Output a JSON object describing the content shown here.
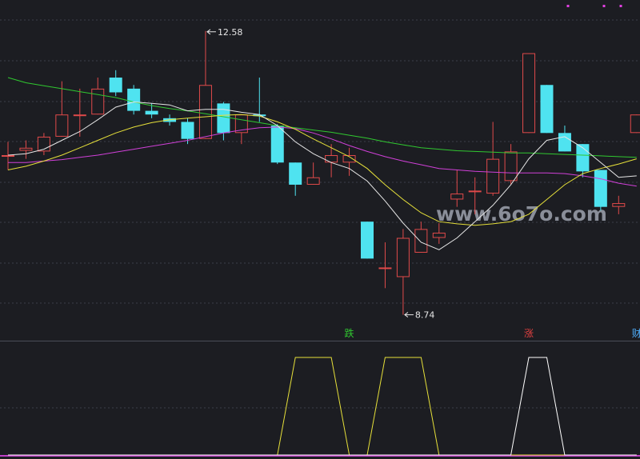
{
  "colors": {
    "background": "#1c1d22",
    "grid": "#3c3f4a",
    "divider": "#4a4d57",
    "up": "#e04a4a",
    "down": "#4fe3f0",
    "ma_white": "#e6e6e6",
    "ma_yellow": "#e6e03a",
    "ma_magenta": "#d040d8",
    "ma_green": "#30c830",
    "osc_yellow": "#e6e03a",
    "osc_white": "#ffffff",
    "baseline": "#c040c8",
    "marker": "#e040e0",
    "label_die": "#30c830",
    "label_zhang": "#e04040",
    "label_cai": "#4fb0ff",
    "watermark": "#8a8e99",
    "annotation": "#e6e6e6"
  },
  "watermark": "www.6o7o.com",
  "annotations": {
    "high_label": "12.58",
    "low_label": "8.74"
  },
  "signals": [
    {
      "text": "跌",
      "candle": 19,
      "color_key": "label_die"
    },
    {
      "text": "涨",
      "candle": 29,
      "color_key": "label_zhang"
    },
    {
      "text": "财",
      "candle": 35,
      "color_key": "label_cai"
    }
  ],
  "chart_data": {
    "type": "candlestick",
    "title": "",
    "ylim": [
      8.4,
      13.0
    ],
    "grid": true,
    "high_index": 11,
    "low_index": 22,
    "candles": [
      {
        "o": 10.9,
        "c": 10.9,
        "h": 11.08,
        "l": 10.7
      },
      {
        "o": 10.96,
        "c": 11.0,
        "h": 11.1,
        "l": 10.85
      },
      {
        "o": 10.95,
        "c": 11.15,
        "h": 11.2,
        "l": 10.9
      },
      {
        "o": 11.15,
        "c": 11.45,
        "h": 11.9,
        "l": 11.15
      },
      {
        "o": 11.45,
        "c": 11.45,
        "h": 11.8,
        "l": 11.15
      },
      {
        "o": 11.45,
        "c": 11.8,
        "h": 11.95,
        "l": 11.45
      },
      {
        "o": 11.95,
        "c": 11.75,
        "h": 12.05,
        "l": 11.7
      },
      {
        "o": 11.8,
        "c": 11.5,
        "h": 11.85,
        "l": 11.45
      },
      {
        "o": 11.5,
        "c": 11.45,
        "h": 11.6,
        "l": 11.4
      },
      {
        "o": 11.4,
        "c": 11.35,
        "h": 11.45,
        "l": 11.3
      },
      {
        "o": 11.35,
        "c": 11.12,
        "h": 11.4,
        "l": 11.05
      },
      {
        "o": 11.12,
        "c": 11.85,
        "h": 12.58,
        "l": 11.12
      },
      {
        "o": 11.6,
        "c": 11.2,
        "h": 11.62,
        "l": 11.1
      },
      {
        "o": 11.2,
        "c": 11.45,
        "h": 11.45,
        "l": 11.05
      },
      {
        "o": 11.45,
        "c": 11.43,
        "h": 11.95,
        "l": 11.35
      },
      {
        "o": 11.3,
        "c": 10.8,
        "h": 11.32,
        "l": 10.78
      },
      {
        "o": 10.8,
        "c": 10.5,
        "h": 10.8,
        "l": 10.35
      },
      {
        "o": 10.5,
        "c": 10.6,
        "h": 10.8,
        "l": 10.5
      },
      {
        "o": 10.8,
        "c": 10.9,
        "h": 11.05,
        "l": 10.6
      },
      {
        "o": 10.8,
        "c": 10.9,
        "h": 11.0,
        "l": 10.62
      },
      {
        "o": 10.0,
        "c": 9.5,
        "h": 10.0,
        "l": 9.5
      },
      {
        "o": 9.38,
        "c": 9.38,
        "h": 9.72,
        "l": 9.1
      },
      {
        "o": 9.25,
        "c": 9.78,
        "h": 9.9,
        "l": 8.74
      },
      {
        "o": 9.58,
        "c": 9.9,
        "h": 10.0,
        "l": 9.58
      },
      {
        "o": 9.78,
        "c": 9.85,
        "h": 9.98,
        "l": 9.7
      },
      {
        "o": 10.3,
        "c": 10.38,
        "h": 10.7,
        "l": 10.2
      },
      {
        "o": 10.42,
        "c": 10.42,
        "h": 10.6,
        "l": 10.1
      },
      {
        "o": 10.38,
        "c": 10.85,
        "h": 11.35,
        "l": 10.35
      },
      {
        "o": 10.55,
        "c": 10.95,
        "h": 11.05,
        "l": 10.5
      },
      {
        "o": 11.2,
        "c": 12.28,
        "h": 12.28,
        "l": 11.2
      },
      {
        "o": 11.85,
        "c": 11.2,
        "h": 11.85,
        "l": 11.2
      },
      {
        "o": 11.2,
        "c": 10.95,
        "h": 11.3,
        "l": 10.95
      },
      {
        "o": 11.05,
        "c": 10.68,
        "h": 11.05,
        "l": 10.6
      },
      {
        "o": 10.7,
        "c": 10.2,
        "h": 10.7,
        "l": 10.15
      },
      {
        "o": 10.2,
        "c": 10.25,
        "h": 10.35,
        "l": 10.1
      },
      {
        "o": 11.2,
        "c": 11.45,
        "h": 11.45,
        "l": 11.2
      }
    ],
    "ma_white": [
      10.9,
      10.92,
      10.98,
      11.1,
      11.22,
      11.38,
      11.55,
      11.62,
      11.6,
      11.58,
      11.5,
      11.52,
      11.52,
      11.48,
      11.45,
      11.3,
      11.08,
      10.92,
      10.8,
      10.72,
      10.55,
      10.28,
      9.98,
      9.72,
      9.62,
      9.78,
      10.0,
      10.22,
      10.5,
      10.85,
      11.1,
      11.15,
      11.0,
      10.8,
      10.6,
      10.62
    ],
    "ma_yellow": [
      10.7,
      10.75,
      10.82,
      10.9,
      11.0,
      11.1,
      11.2,
      11.28,
      11.34,
      11.38,
      11.4,
      11.42,
      11.44,
      11.45,
      11.43,
      11.35,
      11.25,
      11.12,
      11.0,
      10.88,
      10.72,
      10.5,
      10.3,
      10.12,
      10.0,
      9.97,
      9.95,
      9.97,
      10.0,
      10.1,
      10.3,
      10.5,
      10.65,
      10.72,
      10.78,
      10.85
    ],
    "ma_magenta": [
      10.8,
      10.8,
      10.82,
      10.84,
      10.87,
      10.9,
      10.94,
      10.98,
      11.02,
      11.06,
      11.1,
      11.15,
      11.2,
      11.24,
      11.27,
      11.28,
      11.26,
      11.2,
      11.12,
      11.03,
      10.95,
      10.88,
      10.82,
      10.77,
      10.72,
      10.7,
      10.68,
      10.67,
      10.66,
      10.66,
      10.66,
      10.65,
      10.62,
      10.58,
      10.52,
      10.48
    ],
    "ma_green": [
      11.95,
      11.88,
      11.84,
      11.8,
      11.76,
      11.72,
      11.68,
      11.62,
      11.57,
      11.53,
      11.5,
      11.46,
      11.42,
      11.38,
      11.34,
      11.3,
      11.27,
      11.24,
      11.21,
      11.17,
      11.13,
      11.08,
      11.04,
      11.0,
      10.98,
      10.96,
      10.95,
      10.94,
      10.93,
      10.93,
      10.92,
      10.91,
      10.9,
      10.89,
      10.88,
      10.87
    ],
    "oscillator": {
      "ylim": [
        0,
        1
      ],
      "yellow": [
        0,
        0,
        0,
        0,
        0,
        0,
        0,
        0,
        0,
        0,
        0,
        0,
        0,
        0,
        0,
        0,
        1,
        1,
        1,
        0,
        0,
        1,
        1,
        1,
        0,
        0,
        0,
        0,
        0,
        0,
        0,
        0,
        0,
        0,
        0,
        0
      ],
      "white": [
        0,
        0,
        0,
        0,
        0,
        0,
        0,
        0,
        0,
        0,
        0,
        0,
        0,
        0,
        0,
        0,
        0,
        0,
        0,
        0,
        0,
        0,
        0,
        0,
        0,
        0,
        0,
        0,
        0,
        1,
        1,
        0,
        0,
        0,
        0,
        0
      ]
    }
  }
}
